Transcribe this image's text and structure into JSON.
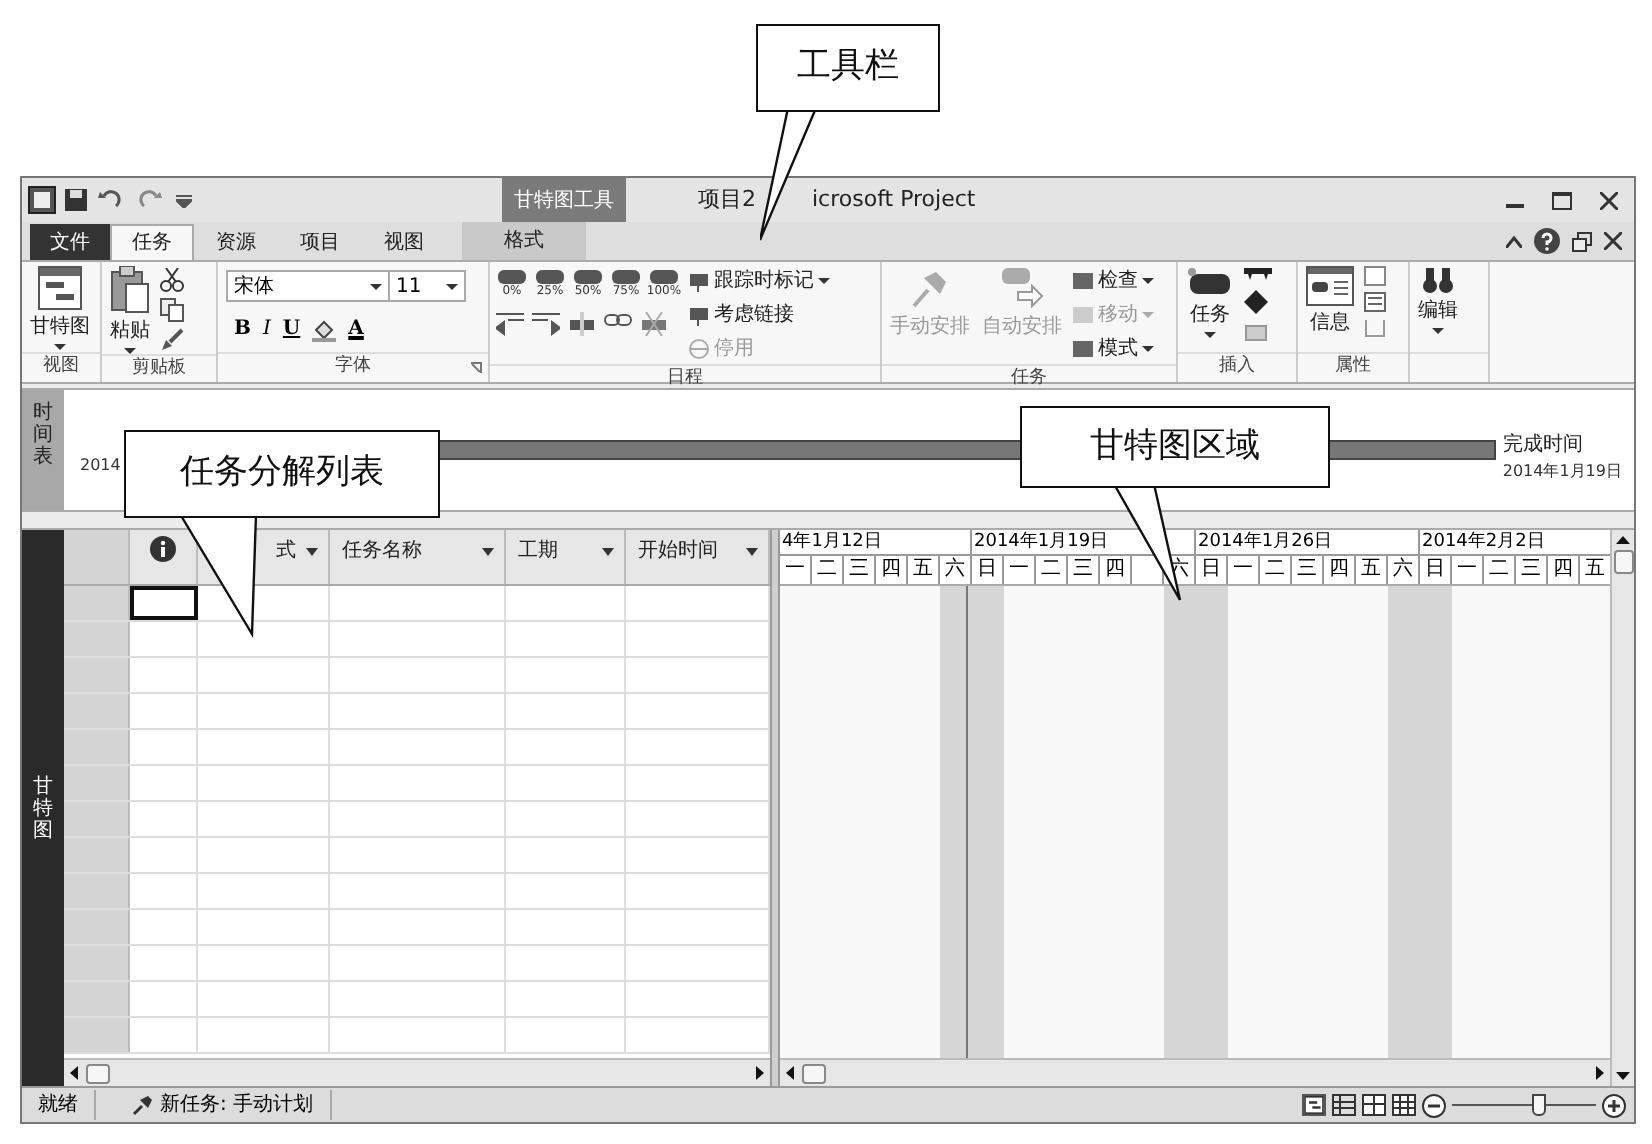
{
  "callouts": [
    {
      "text": "工具栏",
      "kind": "toolbar"
    },
    {
      "text": "任务分解列表",
      "kind": "table"
    },
    {
      "text": "甘特图区域",
      "kind": "gantt"
    }
  ],
  "window": {
    "context_tab": "甘特图工具",
    "title_left": "项目2",
    "title_right": "icrosoft Project"
  },
  "ribbon_tabs": [
    {
      "label": "文件",
      "kind": "file",
      "selected": false
    },
    {
      "label": "任务",
      "kind": "tab",
      "selected": true
    },
    {
      "label": "资源",
      "kind": "tab",
      "selected": false
    },
    {
      "label": "项目",
      "kind": "tab",
      "selected": false
    },
    {
      "label": "视图",
      "kind": "tab",
      "selected": false
    },
    {
      "label": "格式",
      "kind": "context",
      "selected": false
    }
  ],
  "ribbon": {
    "view_group": {
      "label": "视图",
      "button": "甘特图"
    },
    "clipboard_group": {
      "label": "剪贴板",
      "button": "粘贴"
    },
    "font_group": {
      "label": "字体",
      "font_name": "宋体",
      "font_size": "11",
      "bold": "B",
      "italic": "I",
      "underline": "U",
      "font_color": "A"
    },
    "schedule_group": {
      "label": "日程",
      "percents": [
        "0%",
        "25%",
        "50%",
        "75%",
        "100%"
      ],
      "buttons": [
        {
          "label": "跟踪时标记",
          "disabled": false,
          "dropdown": true
        },
        {
          "label": "考虑链接",
          "disabled": false,
          "dropdown": false
        },
        {
          "label": "停用",
          "disabled": true,
          "dropdown": false
        }
      ]
    },
    "tasks_group": {
      "label": "任务",
      "large": [
        {
          "label": "手动安排",
          "disabled": true
        },
        {
          "label": "自动安排",
          "disabled": true
        }
      ],
      "buttons": [
        {
          "label": "检查",
          "disabled": false,
          "dropdown": true
        },
        {
          "label": "移动",
          "disabled": true,
          "dropdown": true
        },
        {
          "label": "模式",
          "disabled": false,
          "dropdown": true
        }
      ]
    },
    "insert_group": {
      "label": "插入",
      "button": "任务"
    },
    "properties_group": {
      "label": "属性",
      "button": "信息"
    },
    "editing": {
      "button": "编辑"
    }
  },
  "timeline": {
    "side_label": "时间表",
    "start_fragment": "2014",
    "finish_label": "完成时间",
    "finish_date": "2014年1月19日"
  },
  "side_label": "甘特图",
  "table": {
    "columns": [
      {
        "kind": "info"
      },
      {
        "kind": "text",
        "label": "式"
      },
      {
        "kind": "text",
        "label": "任务名称"
      },
      {
        "kind": "text",
        "label": "工期"
      },
      {
        "kind": "text",
        "label": "开始时间"
      }
    ],
    "rows": [
      {
        "selected": true
      },
      {
        "selected": false
      },
      {
        "selected": false
      },
      {
        "selected": false
      },
      {
        "selected": false
      },
      {
        "selected": false
      },
      {
        "selected": false
      },
      {
        "selected": false
      },
      {
        "selected": false
      },
      {
        "selected": false
      },
      {
        "selected": false
      },
      {
        "selected": false
      },
      {
        "selected": false
      }
    ]
  },
  "gantt": {
    "weeks": [
      {
        "label": "4年1月12日"
      },
      {
        "label": "2014年1月19日"
      },
      {
        "label": "2014年1月26日"
      },
      {
        "label": "2014年2月2日"
      }
    ],
    "days": [
      {
        "label": "一",
        "shaded": false
      },
      {
        "label": "二",
        "shaded": false
      },
      {
        "label": "三",
        "shaded": false
      },
      {
        "label": "四",
        "shaded": false
      },
      {
        "label": "五",
        "shaded": false
      },
      {
        "label": "六",
        "shaded": true
      },
      {
        "label": "日",
        "shaded": true
      },
      {
        "label": "一",
        "shaded": false
      },
      {
        "label": "二",
        "shaded": false
      },
      {
        "label": "三",
        "shaded": false
      },
      {
        "label": "四",
        "shaded": false
      },
      {
        "shaded": false
      },
      {
        "label": "六",
        "shaded": true
      },
      {
        "label": "日",
        "shaded": true
      },
      {
        "label": "一",
        "shaded": false
      },
      {
        "label": "二",
        "shaded": false
      },
      {
        "label": "三",
        "shaded": false
      },
      {
        "label": "四",
        "shaded": false
      },
      {
        "label": "五",
        "shaded": false
      },
      {
        "label": "六",
        "shaded": true
      },
      {
        "label": "日",
        "shaded": true
      },
      {
        "label": "一",
        "shaded": false
      },
      {
        "label": "二",
        "shaded": false
      },
      {
        "label": "三",
        "shaded": false
      },
      {
        "label": "四",
        "shaded": false
      },
      {
        "label": "五",
        "shaded": false
      }
    ]
  },
  "status_bar": {
    "ready": "就绪",
    "new_task": "新任务: 手动计划",
    "zoom": {
      "level": 0.62
    }
  }
}
